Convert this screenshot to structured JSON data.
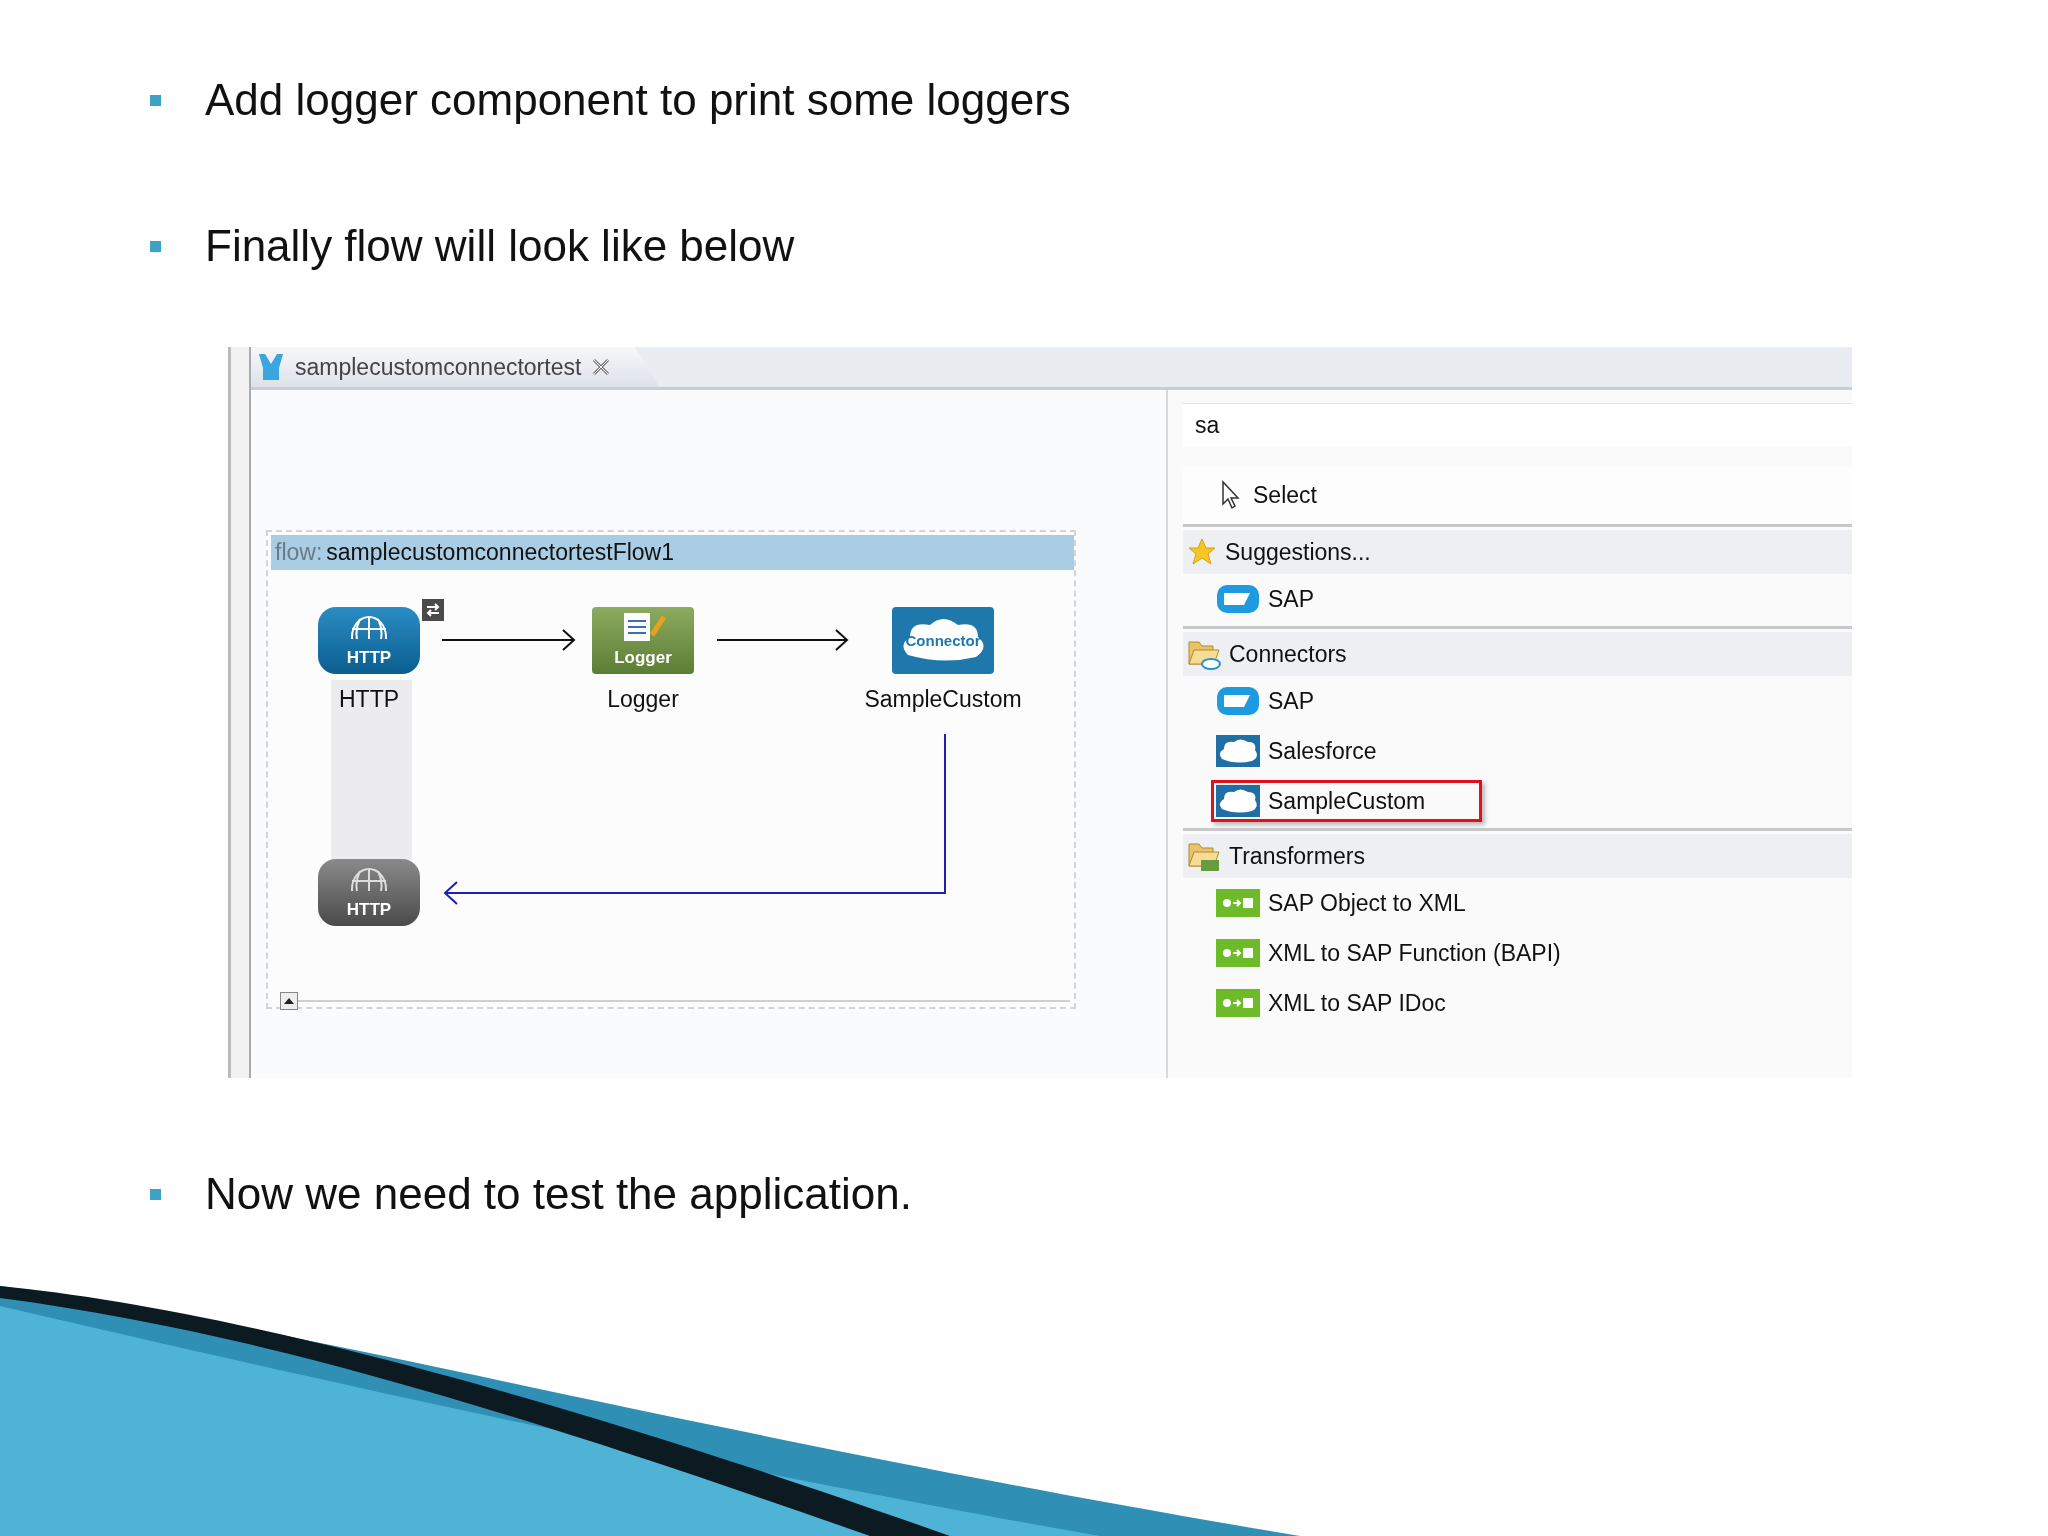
{
  "bullets": [
    {
      "text": "Add logger component to print some loggers"
    },
    {
      "text": "Finally flow will look like below"
    }
  ],
  "screenshot": {
    "editor_tab": {
      "title": "samplecustomconnectortest",
      "selected": true
    },
    "flow": {
      "prefix": "flow:",
      "name": "samplecustomconnectortestFlow1",
      "nodes": [
        {
          "kind": "http",
          "badge": "HTTP",
          "label": "HTTP"
        },
        {
          "kind": "logger",
          "badge": "Logger",
          "label": "Logger"
        },
        {
          "kind": "connector",
          "badge": "Connector",
          "label": "SampleCustom"
        }
      ],
      "response_node": {
        "kind": "http",
        "badge": "HTTP"
      }
    },
    "palette": {
      "search": {
        "value": "sa"
      },
      "select_tool": {
        "label": "Select"
      },
      "sections": [
        {
          "kind": "suggestions",
          "title": "Suggestions...",
          "items": [
            {
              "kind": "sap",
              "label": "SAP",
              "highlighted": false
            }
          ]
        },
        {
          "kind": "connectors",
          "title": "Connectors",
          "items": [
            {
              "kind": "sap",
              "label": "SAP",
              "highlighted": false
            },
            {
              "kind": "cloud",
              "label": "Salesforce",
              "highlighted": false
            },
            {
              "kind": "cloud",
              "label": "SampleCustom",
              "highlighted": true
            }
          ]
        },
        {
          "kind": "transformers",
          "title": "Transformers",
          "items": [
            {
              "kind": "transformer",
              "label": "SAP Object to XML",
              "highlighted": false
            },
            {
              "kind": "transformer",
              "label": "XML to SAP Function (BAPI)",
              "highlighted": false
            },
            {
              "kind": "transformer",
              "label": "XML to SAP IDoc",
              "highlighted": false
            }
          ]
        }
      ]
    }
  },
  "final_bullets": [
    {
      "text": "Now we need to test the application."
    }
  ]
}
